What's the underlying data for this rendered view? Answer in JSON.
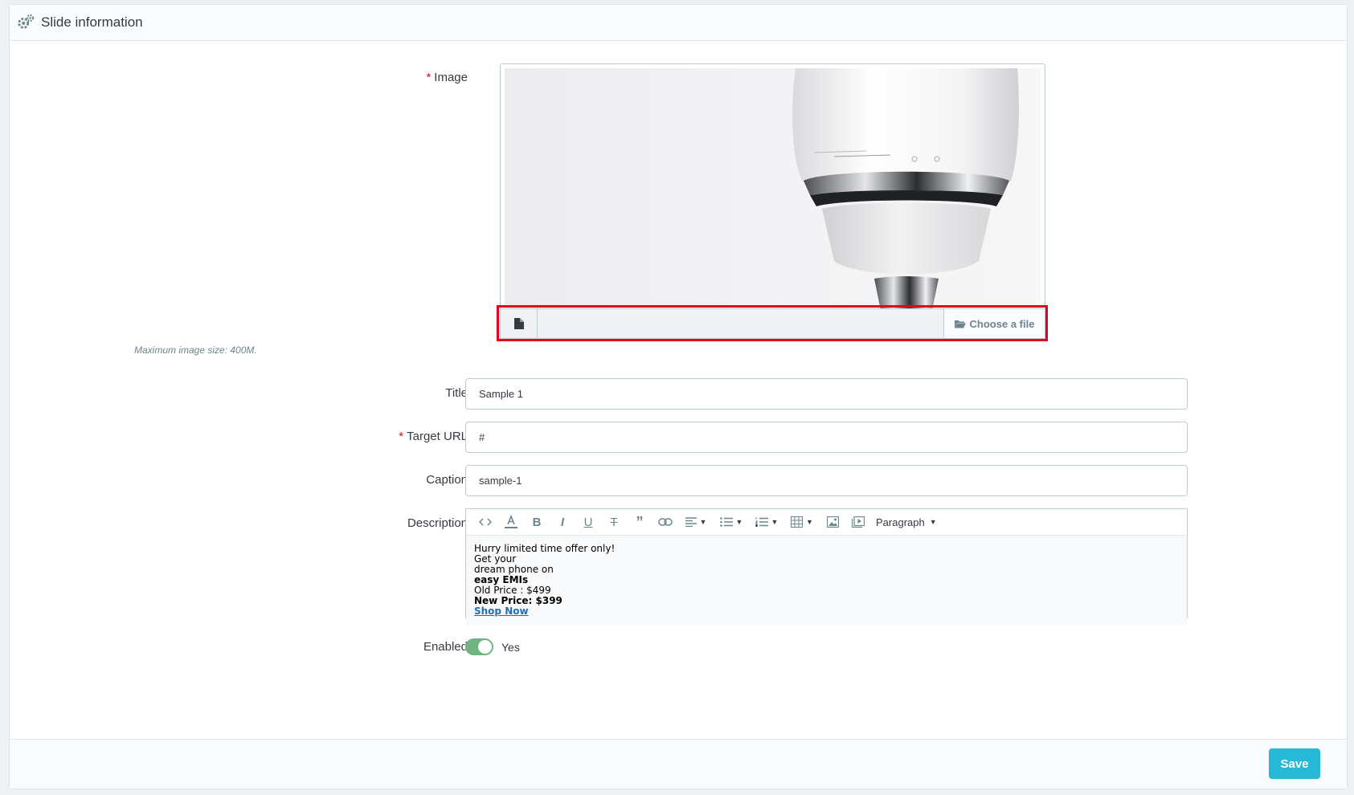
{
  "panel": {
    "title": "Slide information"
  },
  "image_field": {
    "label": "Image",
    "required_mark": "*",
    "choose_label": "Choose a file",
    "filename": "",
    "help": "Maximum image size: 400M."
  },
  "title_field": {
    "label": "Title",
    "value": "Sample 1"
  },
  "url_field": {
    "label": "Target URL",
    "required_mark": "*",
    "value": "#"
  },
  "caption_field": {
    "label": "Caption",
    "value": "sample-1"
  },
  "description_field": {
    "label": "Description",
    "format_label": "Paragraph",
    "toolbar_icons": [
      "code-icon",
      "font-color-icon",
      "bold-icon",
      "italic-icon",
      "underline-icon",
      "strikethrough-icon",
      "blockquote-icon",
      "link-icon",
      "align-icon",
      "bullet-list-icon",
      "numbered-list-icon",
      "table-icon",
      "image-icon",
      "media-icon"
    ],
    "content": {
      "line1": "Hurry limited time offer only!",
      "line2": "Get your",
      "line3": "dream phone on",
      "line4": "easy EMIs",
      "line5": "Old Price : $499",
      "line6": "New Price: $399",
      "link": "Shop Now"
    }
  },
  "enabled_field": {
    "label": "Enabled",
    "state_label": "Yes",
    "on": true
  },
  "footer": {
    "save_label": "Save"
  },
  "colors": {
    "accent": "#25b9d7",
    "toggle_on": "#70b580",
    "highlight": "#e5001b",
    "required": "#e30b0b"
  }
}
